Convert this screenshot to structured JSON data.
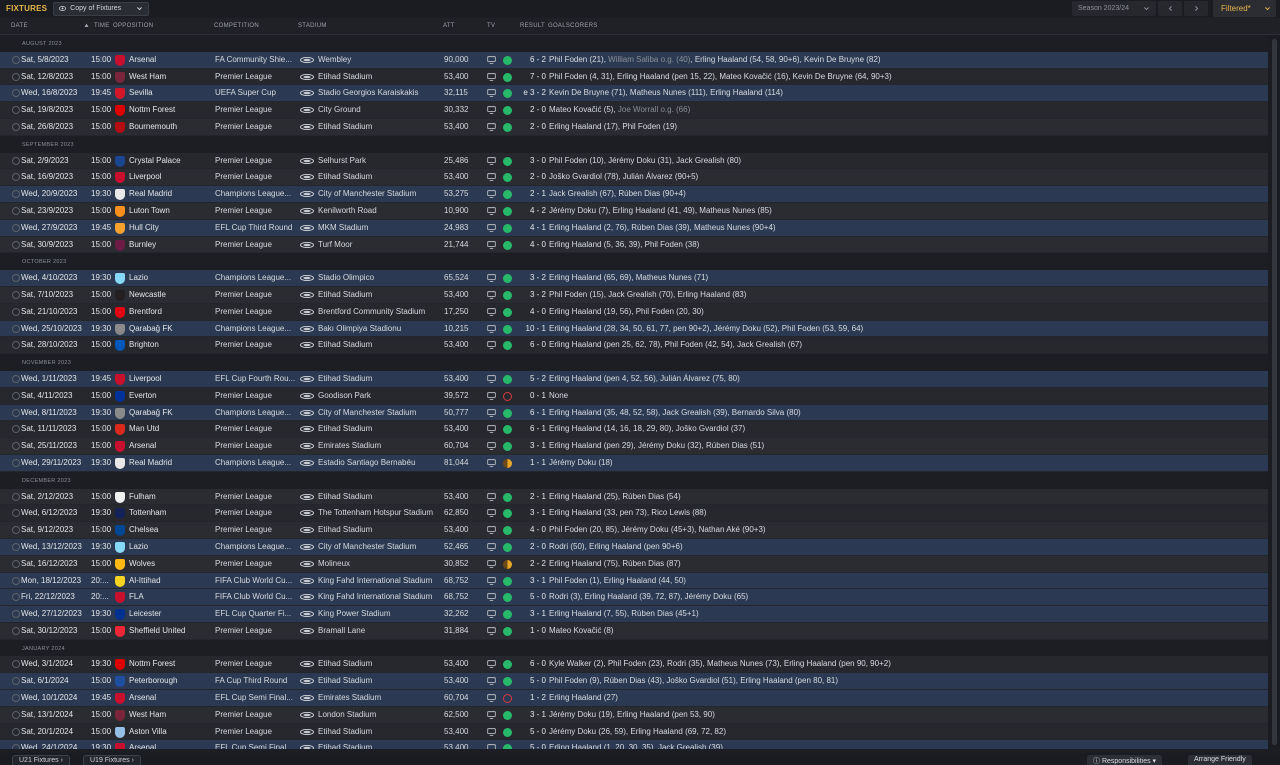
{
  "header": {
    "title": "FIXTURES",
    "view": "Copy of Fixtures",
    "season": "Season 2023/24",
    "filter": "Filtered*"
  },
  "columns": {
    "date": "DATE",
    "time": "TIME",
    "opposition": "OPPOSITION",
    "competition": "COMPETITION",
    "stadium": "STADIUM",
    "att": "ATT",
    "tv": "TV",
    "result": "RESULT",
    "goalscorers": "GOALSCORERS"
  },
  "colors": {
    "win": "#27b86a",
    "draw": "#e8a62a",
    "loss": "#d8373e",
    "accent": "#e8b548",
    "highlight_row": "#2b3a52"
  },
  "groups": [
    {
      "month": "AUGUST 2023",
      "rows": [
        {
          "date": "Sat, 5/8/2023",
          "time": "15:00",
          "opp": "Arsenal",
          "badge": "#c8102e",
          "comp": "FA Community Shie...",
          "stadium": "Wembley",
          "att": "90,000",
          "tv": true,
          "outcome": "w",
          "result": "6 - 2",
          "scorers": "Phil Foden (21), ",
          "og": "William Saliba o.g. (40)",
          "scorers2": ", Erling Haaland (54, 58, 90+6), Kevin De Bruyne (82)",
          "hl": true
        },
        {
          "date": "Sat, 12/8/2023",
          "time": "15:00",
          "opp": "West Ham",
          "badge": "#7a263a",
          "comp": "Premier League",
          "stadium": "Etihad Stadium",
          "att": "53,400",
          "tv": true,
          "outcome": "w",
          "result": "7 - 0",
          "scorers": "Phil Foden (4, 31), Erling Haaland (pen 15, 22), Mateo Kovačić (16), Kevin De Bruyne (64, 90+3)"
        },
        {
          "date": "Wed, 16/8/2023",
          "time": "19:45",
          "opp": "Sevilla",
          "badge": "#d2172b",
          "comp": "UEFA Super Cup",
          "stadium": "Stadio Georgios Karaiskakis",
          "att": "32,115",
          "tv": true,
          "outcome": "w",
          "result": "e 3 - 2",
          "scorers": "Kevin De Bruyne (71), Matheus Nunes (111), Erling Haaland (114)",
          "hl": true
        },
        {
          "date": "Sat, 19/8/2023",
          "time": "15:00",
          "opp": "Nottm Forest",
          "badge": "#dd0000",
          "comp": "Premier League",
          "stadium": "City Ground",
          "att": "30,332",
          "tv": true,
          "outcome": "w",
          "result": "2 - 0",
          "scorers": "Mateo Kovačić (5), ",
          "og": "Joe Worrall o.g. (66)"
        },
        {
          "date": "Sat, 26/8/2023",
          "time": "15:00",
          "opp": "Bournemouth",
          "badge": "#b50e12",
          "comp": "Premier League",
          "stadium": "Etihad Stadium",
          "att": "53,400",
          "tv": true,
          "outcome": "w",
          "result": "2 - 0",
          "scorers": "Erling Haaland (17), Phil Foden (19)"
        }
      ]
    },
    {
      "month": "SEPTEMBER 2023",
      "rows": [
        {
          "date": "Sat, 2/9/2023",
          "time": "15:00",
          "opp": "Crystal Palace",
          "badge": "#1b458f",
          "comp": "Premier League",
          "stadium": "Selhurst Park",
          "att": "25,486",
          "tv": true,
          "outcome": "w",
          "result": "3 - 0",
          "scorers": "Phil Foden (10), Jérémy Doku (31), Jack Grealish (80)"
        },
        {
          "date": "Sat, 16/9/2023",
          "time": "15:00",
          "opp": "Liverpool",
          "badge": "#c8102e",
          "comp": "Premier League",
          "stadium": "Etihad Stadium",
          "att": "53,400",
          "tv": true,
          "outcome": "w",
          "result": "2 - 0",
          "scorers": "Joško Gvardiol (78), Julián Álvarez (90+5)"
        },
        {
          "date": "Wed, 20/9/2023",
          "time": "19:30",
          "opp": "Real Madrid",
          "badge": "#e8e8e8",
          "comp": "Champions League...",
          "stadium": "City of Manchester Stadium",
          "att": "53,275",
          "tv": true,
          "outcome": "w",
          "result": "2 - 1",
          "scorers": "Jack Grealish (67), Rúben Dias (90+4)",
          "hl": true
        },
        {
          "date": "Sat, 23/9/2023",
          "time": "15:00",
          "opp": "Luton Town",
          "badge": "#f78f1e",
          "comp": "Premier League",
          "stadium": "Kenilworth Road",
          "att": "10,900",
          "tv": true,
          "outcome": "w",
          "result": "4 - 2",
          "scorers": "Jérémy Doku (7), Erling Haaland (41, 49), Matheus Nunes (85)"
        },
        {
          "date": "Wed, 27/9/2023",
          "time": "19:45",
          "opp": "Hull City",
          "badge": "#f5a12d",
          "comp": "EFL Cup Third Round",
          "stadium": "MKM Stadium",
          "att": "24,983",
          "tv": true,
          "outcome": "w",
          "result": "4 - 1",
          "scorers": "Erling Haaland (2, 76), Rúben Dias (39), Matheus Nunes (90+4)",
          "hl": true
        },
        {
          "date": "Sat, 30/9/2023",
          "time": "15:00",
          "opp": "Burnley",
          "badge": "#6c1d45",
          "comp": "Premier League",
          "stadium": "Turf Moor",
          "att": "21,744",
          "tv": true,
          "outcome": "w",
          "result": "4 - 0",
          "scorers": "Erling Haaland (5, 36, 39), Phil Foden (38)"
        }
      ]
    },
    {
      "month": "OCTOBER 2023",
      "rows": [
        {
          "date": "Wed, 4/10/2023",
          "time": "19:30",
          "opp": "Lazio",
          "badge": "#87d8f7",
          "comp": "Champions League...",
          "stadium": "Stadio Olimpico",
          "att": "65,524",
          "tv": true,
          "outcome": "w",
          "result": "3 - 2",
          "scorers": "Erling Haaland (65, 69), Matheus Nunes (71)",
          "hl": true
        },
        {
          "date": "Sat, 7/10/2023",
          "time": "15:00",
          "opp": "Newcastle",
          "badge": "#241f20",
          "comp": "Premier League",
          "stadium": "Etihad Stadium",
          "att": "53,400",
          "tv": true,
          "outcome": "w",
          "result": "3 - 2",
          "scorers": "Phil Foden (15), Jack Grealish (70), Erling Haaland (83)"
        },
        {
          "date": "Sat, 21/10/2023",
          "time": "15:00",
          "opp": "Brentford",
          "badge": "#e30613",
          "comp": "Premier League",
          "stadium": "Brentford Community Stadium",
          "att": "17,250",
          "tv": true,
          "outcome": "w",
          "result": "4 - 0",
          "scorers": "Erling Haaland (19, 56), Phil Foden (20, 30)"
        },
        {
          "date": "Wed, 25/10/2023",
          "time": "19:30",
          "opp": "Qarabağ FK",
          "badge": "#8a8a8a",
          "comp": "Champions League...",
          "stadium": "Bakı Olimpiya Stadionu",
          "att": "10,215",
          "tv": true,
          "outcome": "w",
          "result": "10 - 1",
          "scorers": "Erling Haaland (28, 34, 50, 61, 77, pen 90+2), Jérémy Doku (52), Phil Foden (53, 59, 64)",
          "hl": true
        },
        {
          "date": "Sat, 28/10/2023",
          "time": "15:00",
          "opp": "Brighton",
          "badge": "#0057b8",
          "comp": "Premier League",
          "stadium": "Etihad Stadium",
          "att": "53,400",
          "tv": true,
          "outcome": "w",
          "result": "6 - 0",
          "scorers": "Erling Haaland (pen 25, 62, 78), Phil Foden (42, 54), Jack Grealish (67)"
        }
      ]
    },
    {
      "month": "NOVEMBER 2023",
      "rows": [
        {
          "date": "Wed, 1/11/2023",
          "time": "19:45",
          "opp": "Liverpool",
          "badge": "#c8102e",
          "comp": "EFL Cup Fourth Rou...",
          "stadium": "Etihad Stadium",
          "att": "53,400",
          "tv": true,
          "outcome": "w",
          "result": "5 - 2",
          "scorers": "Erling Haaland (pen 4, 52, 56), Julián Álvarez (75, 80)",
          "hl": true
        },
        {
          "date": "Sat, 4/11/2023",
          "time": "15:00",
          "opp": "Everton",
          "badge": "#003399",
          "comp": "Premier League",
          "stadium": "Goodison Park",
          "att": "39,572",
          "tv": true,
          "outcome": "l",
          "result": "0 - 1",
          "scorers": "None"
        },
        {
          "date": "Wed, 8/11/2023",
          "time": "19:30",
          "opp": "Qarabağ FK",
          "badge": "#8a8a8a",
          "comp": "Champions League...",
          "stadium": "City of Manchester Stadium",
          "att": "50,777",
          "tv": true,
          "outcome": "w",
          "result": "6 - 1",
          "scorers": "Erling Haaland (35, 48, 52, 58), Jack Grealish (39), Bernardo Silva (80)",
          "hl": true
        },
        {
          "date": "Sat, 11/11/2023",
          "time": "15:00",
          "opp": "Man Utd",
          "badge": "#da291c",
          "comp": "Premier League",
          "stadium": "Etihad Stadium",
          "att": "53,400",
          "tv": true,
          "outcome": "w",
          "result": "6 - 1",
          "scorers": "Erling Haaland (14, 16, 18, 29, 80), Joško Gvardiol (37)"
        },
        {
          "date": "Sat, 25/11/2023",
          "time": "15:00",
          "opp": "Arsenal",
          "badge": "#c8102e",
          "comp": "Premier League",
          "stadium": "Emirates Stadium",
          "att": "60,704",
          "tv": true,
          "outcome": "w",
          "result": "3 - 1",
          "scorers": "Erling Haaland (pen 29), Jérémy Doku (32), Rúben Dias (51)"
        },
        {
          "date": "Wed, 29/11/2023",
          "time": "19:30",
          "opp": "Real Madrid",
          "badge": "#e8e8e8",
          "comp": "Champions League...",
          "stadium": "Estadio Santiago Bernabéu",
          "att": "81,044",
          "tv": true,
          "outcome": "d",
          "result": "1 - 1",
          "scorers": "Jérémy Doku (18)",
          "hl": true
        }
      ]
    },
    {
      "month": "DECEMBER 2023",
      "rows": [
        {
          "date": "Sat, 2/12/2023",
          "time": "15:00",
          "opp": "Fulham",
          "badge": "#f0f0f0",
          "comp": "Premier League",
          "stadium": "Etihad Stadium",
          "att": "53,400",
          "tv": true,
          "outcome": "w",
          "result": "2 - 1",
          "scorers": "Erling Haaland (25), Rúben Dias (54)"
        },
        {
          "date": "Wed, 6/12/2023",
          "time": "19:30",
          "opp": "Tottenham",
          "badge": "#132257",
          "comp": "Premier League",
          "stadium": "The Tottenham Hotspur Stadium",
          "att": "62,850",
          "tv": true,
          "outcome": "w",
          "result": "3 - 1",
          "scorers": "Erling Haaland (33, pen 73), Rico Lewis (88)"
        },
        {
          "date": "Sat, 9/12/2023",
          "time": "15:00",
          "opp": "Chelsea",
          "badge": "#034694",
          "comp": "Premier League",
          "stadium": "Etihad Stadium",
          "att": "53,400",
          "tv": true,
          "outcome": "w",
          "result": "4 - 0",
          "scorers": "Phil Foden (20, 85), Jérémy Doku (45+3), Nathan Aké (90+3)"
        },
        {
          "date": "Wed, 13/12/2023",
          "time": "19:30",
          "opp": "Lazio",
          "badge": "#87d8f7",
          "comp": "Champions League...",
          "stadium": "City of Manchester Stadium",
          "att": "52,465",
          "tv": true,
          "outcome": "w",
          "result": "2 - 0",
          "scorers": "Rodri (50), Erling Haaland (pen 90+6)",
          "hl": true
        },
        {
          "date": "Sat, 16/12/2023",
          "time": "15:00",
          "opp": "Wolves",
          "badge": "#fdb913",
          "comp": "Premier League",
          "stadium": "Molineux",
          "att": "30,852",
          "tv": true,
          "outcome": "d",
          "result": "2 - 2",
          "scorers": "Erling Haaland (75), Rúben Dias (87)"
        },
        {
          "date": "Mon, 18/12/2023",
          "time": "20:...",
          "opp": "Al-Ittihad",
          "badge": "#f4d21f",
          "comp": "FIFA Club World Cu...",
          "stadium": "King Fahd International Stadium",
          "att": "68,752",
          "tv": true,
          "outcome": "w",
          "result": "3 - 1",
          "scorers": "Phil Foden (1), Erling Haaland (44, 50)",
          "hl": true
        },
        {
          "date": "Fri, 22/12/2023",
          "time": "20:...",
          "opp": "FLA",
          "badge": "#c8102e",
          "comp": "FIFA Club World Cu...",
          "stadium": "King Fahd International Stadium",
          "att": "68,752",
          "tv": true,
          "outcome": "w",
          "result": "5 - 0",
          "scorers": "Rodri (3), Erling Haaland (39, 72, 87), Jérémy Doku (65)",
          "hl": true
        },
        {
          "date": "Wed, 27/12/2023",
          "time": "19:30",
          "opp": "Leicester",
          "badge": "#003090",
          "comp": "EFL Cup Quarter Fi...",
          "stadium": "King Power Stadium",
          "att": "32,262",
          "tv": true,
          "outcome": "w",
          "result": "3 - 1",
          "scorers": "Erling Haaland (7, 55), Rúben Dias (45+1)",
          "hl": true
        },
        {
          "date": "Sat, 30/12/2023",
          "time": "15:00",
          "opp": "Sheffield United",
          "badge": "#ee2737",
          "comp": "Premier League",
          "stadium": "Bramall Lane",
          "att": "31,884",
          "tv": true,
          "outcome": "w",
          "result": "1 - 0",
          "scorers": "Mateo Kovačić (8)"
        }
      ]
    },
    {
      "month": "JANUARY 2024",
      "rows": [
        {
          "date": "Wed, 3/1/2024",
          "time": "19:30",
          "opp": "Nottm Forest",
          "badge": "#dd0000",
          "comp": "Premier League",
          "stadium": "Etihad Stadium",
          "att": "53,400",
          "tv": true,
          "outcome": "w",
          "result": "6 - 0",
          "scorers": "Kyle Walker (2), Phil Foden (23), Rodri (35), Matheus Nunes (73), Erling Haaland (pen 90, 90+2)"
        },
        {
          "date": "Sat, 6/1/2024",
          "time": "15:00",
          "opp": "Peterborough",
          "badge": "#1e4fa0",
          "comp": "FA Cup Third Round",
          "stadium": "Etihad Stadium",
          "att": "53,400",
          "tv": true,
          "outcome": "w",
          "result": "5 - 0",
          "scorers": "Phil Foden (9), Rúben Dias (43), Joško Gvardiol (51), Erling Haaland (pen 80, 81)",
          "hl": true
        },
        {
          "date": "Wed, 10/1/2024",
          "time": "19:45",
          "opp": "Arsenal",
          "badge": "#c8102e",
          "comp": "EFL Cup Semi Final...",
          "stadium": "Emirates Stadium",
          "att": "60,704",
          "tv": true,
          "outcome": "l",
          "result": "1 - 2",
          "scorers": "Erling Haaland (27)",
          "hl": true
        },
        {
          "date": "Sat, 13/1/2024",
          "time": "15:00",
          "opp": "West Ham",
          "badge": "#7a263a",
          "comp": "Premier League",
          "stadium": "London Stadium",
          "att": "62,500",
          "tv": true,
          "outcome": "w",
          "result": "3 - 1",
          "scorers": "Jérémy Doku (19), Erling Haaland (pen 53, 90)"
        },
        {
          "date": "Sat, 20/1/2024",
          "time": "15:00",
          "opp": "Aston Villa",
          "badge": "#95bfe5",
          "comp": "Premier League",
          "stadium": "Etihad Stadium",
          "att": "53,400",
          "tv": true,
          "outcome": "w",
          "result": "5 - 0",
          "scorers": "Jérémy Doku (26, 59), Erling Haaland (69, 72, 82)"
        },
        {
          "date": "Wed, 24/1/2024",
          "time": "19:30",
          "opp": "Arsenal",
          "badge": "#c8102e",
          "comp": "EFL Cup Semi Final...",
          "stadium": "Etihad Stadium",
          "att": "53,400",
          "tv": true,
          "outcome": "w",
          "result": "5 - 0",
          "scorers": "Erling Haaland (1, 20, 30, 35), Jack Grealish (39)",
          "hl": true
        }
      ]
    }
  ],
  "footer": {
    "tab_u21": "U21 Fixtures",
    "tab_u19": "U19 Fixtures",
    "responsibilities": "Responsibilities",
    "arrange": "Arrange Friendly"
  }
}
